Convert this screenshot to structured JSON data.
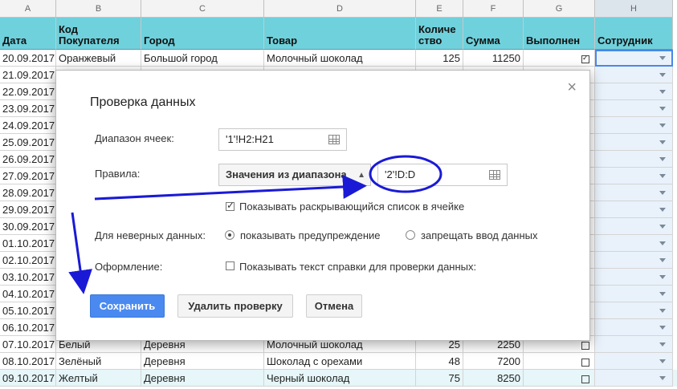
{
  "columns": [
    "A",
    "B",
    "C",
    "D",
    "E",
    "F",
    "G",
    "H"
  ],
  "headers": {
    "a": "Дата",
    "b1": "Код",
    "b2": "Покупателя",
    "c": "Город",
    "d": "Товар",
    "e1": "Количе",
    "e2": "ство",
    "f": "Сумма",
    "g": "Выполнен",
    "h": "Сотрудник"
  },
  "rows": [
    {
      "date": "20.09.2017",
      "code": "Оранжевый",
      "city": "Большой город",
      "product": "Молочный шоколад",
      "qty": "125",
      "sum": "11250",
      "done": true
    },
    {
      "date": "21.09.2017"
    },
    {
      "date": "22.09.2017"
    },
    {
      "date": "23.09.2017"
    },
    {
      "date": "24.09.2017"
    },
    {
      "date": "25.09.2017"
    },
    {
      "date": "26.09.2017"
    },
    {
      "date": "27.09.2017"
    },
    {
      "date": "28.09.2017"
    },
    {
      "date": "29.09.2017"
    },
    {
      "date": "30.09.2017"
    },
    {
      "date": "01.10.2017"
    },
    {
      "date": "02.10.2017"
    },
    {
      "date": "03.10.2017"
    },
    {
      "date": "04.10.2017"
    },
    {
      "date": "05.10.2017"
    },
    {
      "date": "06.10.2017"
    },
    {
      "date": "07.10.2017",
      "code": "Белый",
      "city": "Деревня",
      "product": "Молочный шоколад",
      "qty": "25",
      "sum": "2250",
      "done": false
    },
    {
      "date": "08.10.2017",
      "code": "Зелёный",
      "city": "Деревня",
      "product": "Шоколад с орехами",
      "qty": "48",
      "sum": "7200",
      "done": false
    },
    {
      "date": "09.10.2017",
      "code": "Желтый",
      "city": "Деревня",
      "product": "Черный шоколад",
      "qty": "75",
      "sum": "8250",
      "done": false
    }
  ],
  "dialog": {
    "title": "Проверка данных",
    "range_label": "Диапазон ячеек:",
    "range_value": "'1'!H2:H21",
    "rules_label": "Правила:",
    "rules_select": "Значения из диапазона",
    "rules_range": "'2'!D:D",
    "show_dropdown": "Показывать раскрывающийся список в ячейке",
    "invalid_label": "Для неверных данных:",
    "warn_option": "показывать предупреждение",
    "reject_option": "запрещать ввод данных",
    "appearance_label": "Оформление:",
    "help_text_option": "Показывать текст справки для проверки данных:",
    "save": "Сохранить",
    "remove": "Удалить проверку",
    "cancel": "Отмена",
    "close": "×"
  },
  "colors": {
    "header_bg": "#6fd1dc",
    "accent": "#4a8af0",
    "annotation": "#1a1ad6"
  }
}
